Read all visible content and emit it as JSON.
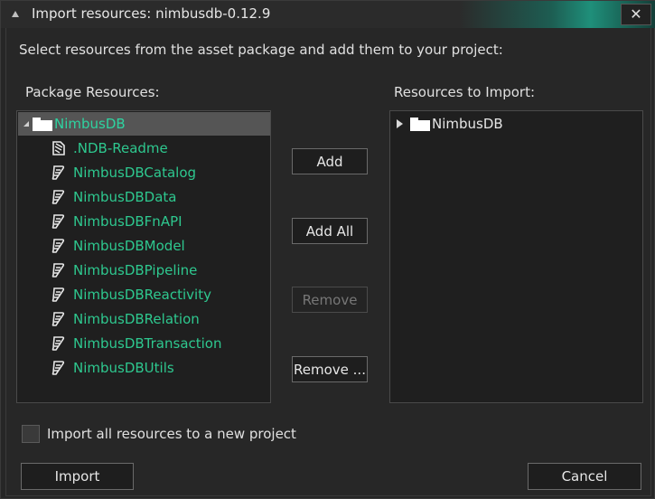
{
  "window": {
    "title": "Import resources: nimbusdb-0.12.9",
    "close_glyph": "✕"
  },
  "instruction": "Select resources from the asset package and add them to your project:",
  "package_resources": {
    "label": "Package Resources:",
    "root": {
      "label": "NimbusDB",
      "icon": "folder-icon",
      "expanded": true,
      "selected": true
    },
    "items": [
      {
        "label": ".NDB-Readme",
        "icon": "note-icon"
      },
      {
        "label": "NimbusDBCatalog",
        "icon": "script-icon"
      },
      {
        "label": "NimbusDBData",
        "icon": "script-icon"
      },
      {
        "label": "NimbusDBFnAPI",
        "icon": "script-icon"
      },
      {
        "label": "NimbusDBModel",
        "icon": "script-icon"
      },
      {
        "label": "NimbusDBPipeline",
        "icon": "script-icon"
      },
      {
        "label": "NimbusDBReactivity",
        "icon": "script-icon"
      },
      {
        "label": "NimbusDBRelation",
        "icon": "script-icon"
      },
      {
        "label": "NimbusDBTransaction",
        "icon": "script-icon"
      },
      {
        "label": "NimbusDBUtils",
        "icon": "script-icon"
      }
    ]
  },
  "resources_to_import": {
    "label": "Resources to Import:",
    "root": {
      "label": "NimbusDB",
      "icon": "folder-icon",
      "expanded": false
    }
  },
  "buttons": {
    "add": "Add",
    "add_all": "Add All",
    "remove": "Remove",
    "remove_dots": "Remove ...",
    "import": "Import",
    "cancel": "Cancel"
  },
  "options": {
    "import_new_project_label": "Import all resources to a new project",
    "import_new_project_checked": false
  },
  "colors": {
    "accent_green": "#2ec88f",
    "titlebar_teal": "#1f8f7a",
    "selection": "#555555"
  }
}
